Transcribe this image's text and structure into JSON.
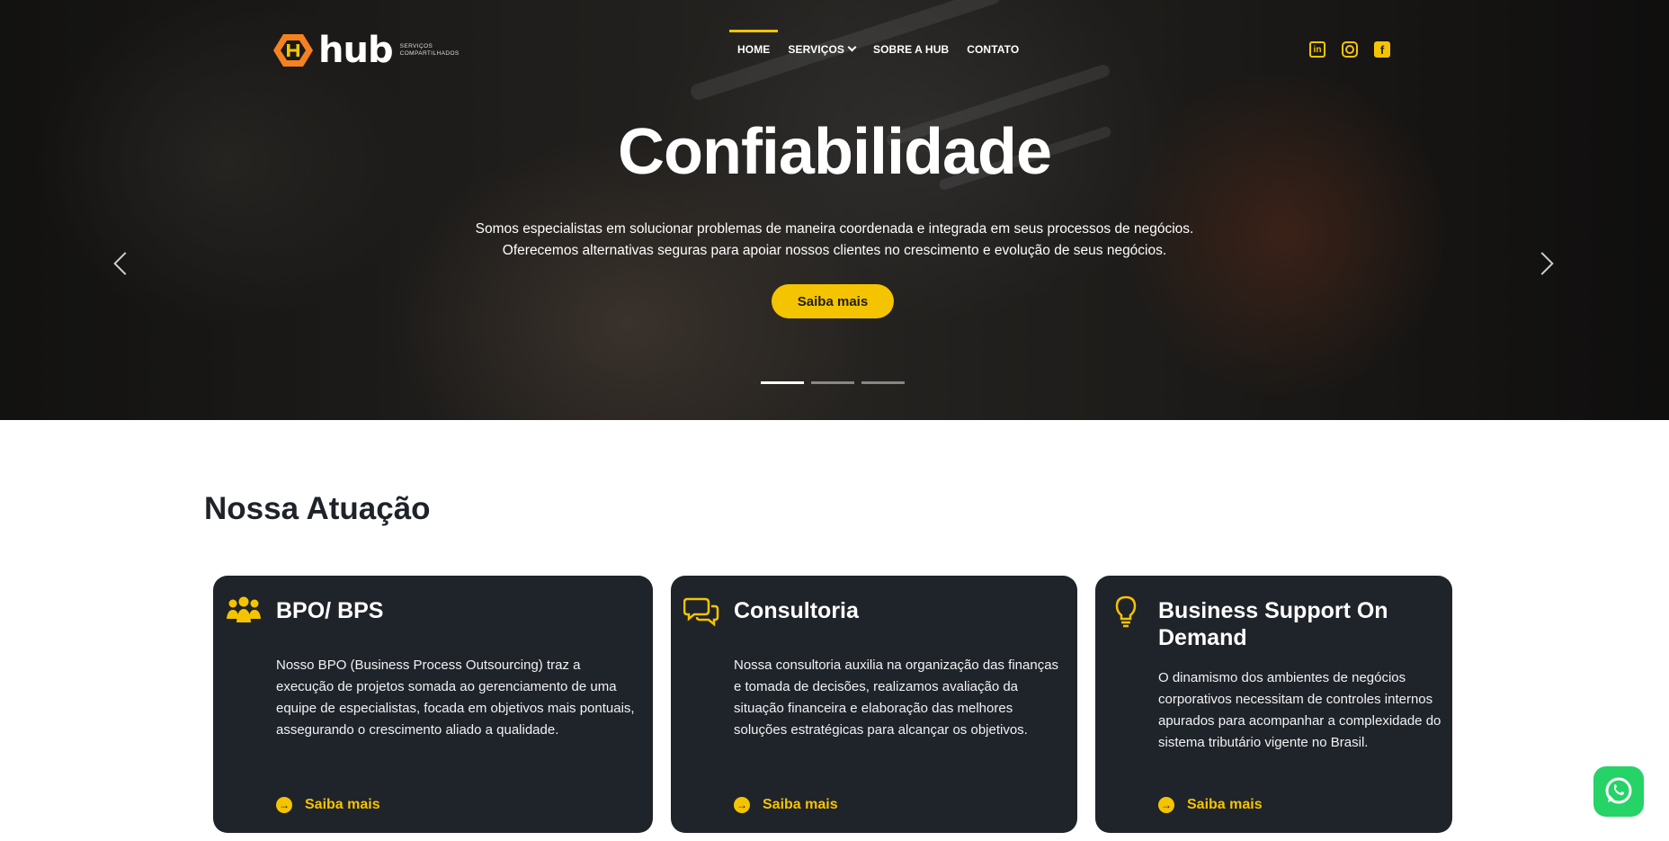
{
  "brand": {
    "name": "hub",
    "tagline_line1": "SERVIÇOS",
    "tagline_line2": "COMPARTILHADOS",
    "accent": "#f5c400"
  },
  "nav": {
    "items": [
      {
        "label": "HOME",
        "active": true
      },
      {
        "label": "SERVIÇOS",
        "has_dropdown": true
      },
      {
        "label": "SOBRE A HUB"
      },
      {
        "label": "CONTATO"
      }
    ]
  },
  "social": [
    "linkedin-icon",
    "instagram-icon",
    "facebook-icon"
  ],
  "hero": {
    "title": "Confiabilidade",
    "text_line1": "Somos especialistas em solucionar problemas de maneira coordenada e integrada em seus processos de negócios.",
    "text_line2": "Oferecemos alternativas seguras para apoiar nossos clientes no crescimento e evolução de seus negócios.",
    "button_label": "Saiba mais",
    "slides_total": 3,
    "active_slide": 1
  },
  "section": {
    "title": "Nossa Atuação",
    "cards": [
      {
        "title": "BPO/ BPS",
        "text": "Nosso BPO (Business Process Outsourcing) traz a execução de projetos somada ao gerenciamento de uma equipe de especialistas, focada em objetivos mais pontuais, assegurando o crescimento aliado a qualidade.",
        "link": "Saiba mais",
        "icon": "team-icon"
      },
      {
        "title": "Consultoria",
        "text": "Nossa consultoria auxilia na organização das finanças e tomada de decisões, realizamos avaliação da situação financeira e elaboração das melhores soluções estratégicas para alcançar os objetivos.",
        "link": "Saiba mais",
        "icon": "chat-icon"
      },
      {
        "title": "Business Support On Demand",
        "text": "O dinamismo dos ambientes de negócios corporativos necessitam de controles internos apurados para acompanhar a complexidade do sistema tributário vigente no Brasil.",
        "link": "Saiba mais",
        "icon": "lightbulb-icon"
      }
    ]
  },
  "floating": {
    "icon": "whatsapp-icon"
  }
}
